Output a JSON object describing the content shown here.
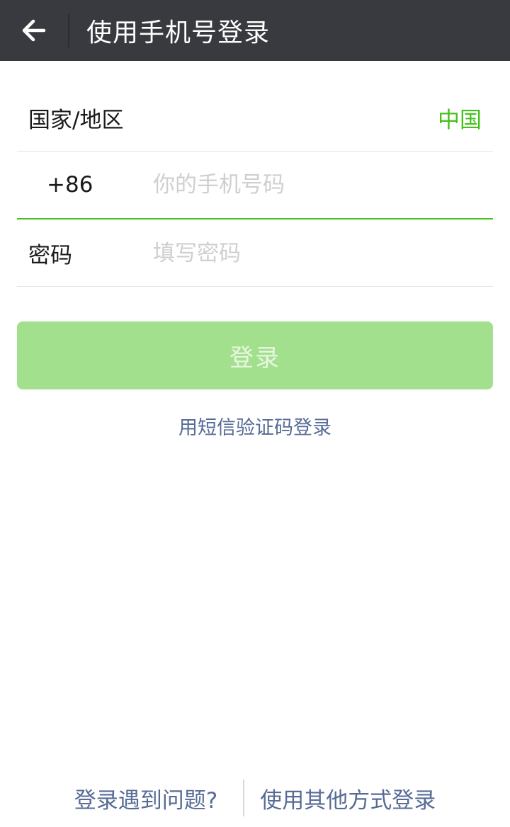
{
  "header": {
    "title": "使用手机号登录",
    "back_icon": "arrow-left-icon"
  },
  "form": {
    "country_label": "国家/地区",
    "country_value": "中国",
    "country_code": "+86",
    "phone_placeholder": "你的手机号码",
    "phone_value": "",
    "password_label": "密码",
    "password_placeholder": "填写密码",
    "password_value": ""
  },
  "actions": {
    "login_label": "登录",
    "sms_login_label": "用短信验证码登录"
  },
  "footer": {
    "trouble_label": "登录遇到问题?",
    "other_methods_label": "使用其他方式登录"
  },
  "colors": {
    "topbar": "#393a3f",
    "accent_green": "#45c01a",
    "login_button_disabled": "#a3e08d",
    "link_blue": "#576b95"
  }
}
